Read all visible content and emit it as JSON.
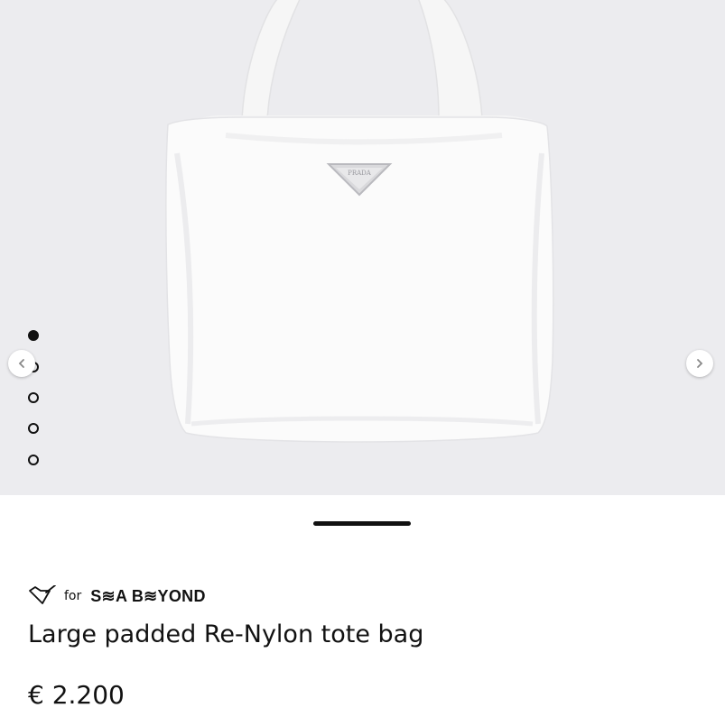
{
  "gallery": {
    "image_alt": "Large padded Re-Nylon tote bag",
    "logo_text": "PRADA",
    "slide_count": 5,
    "active_slide": 1,
    "prev_icon": "chevron-left-icon",
    "next_icon": "chevron-right-icon"
  },
  "badge": {
    "icon": "heart-check-icon",
    "for_label": "for",
    "brand": "S≋A B≋YOND"
  },
  "product": {
    "title": "Large padded Re-Nylon tote bag",
    "price": "€ 2.200"
  },
  "colors": {
    "background": "#ececef",
    "text": "#111111",
    "product": "#ffffff"
  }
}
